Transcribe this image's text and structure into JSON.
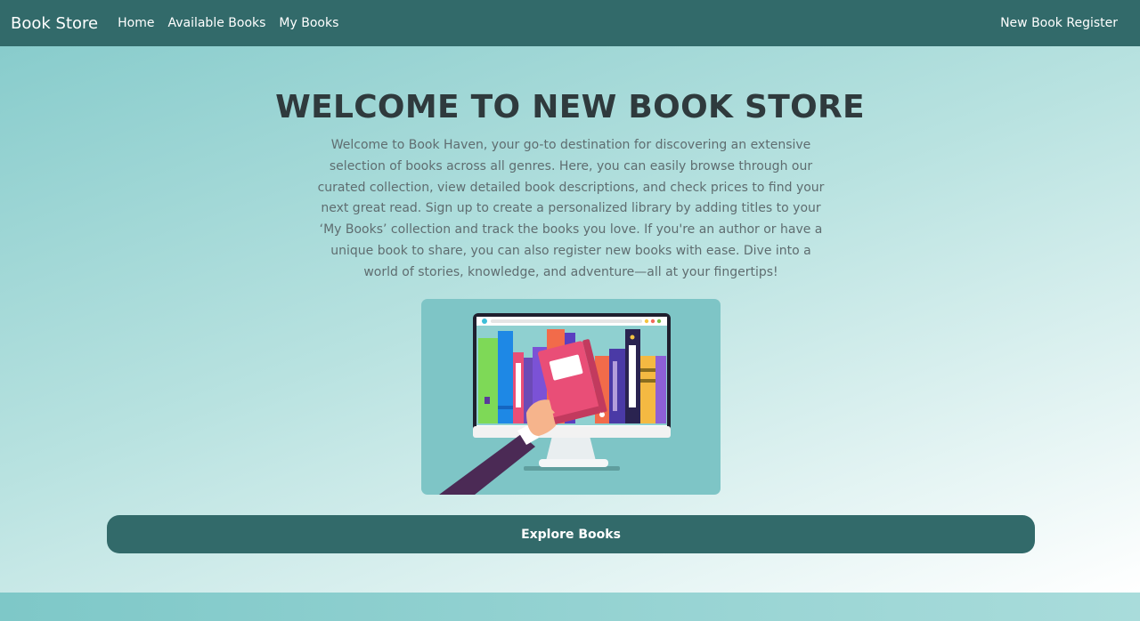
{
  "nav": {
    "brand": "Book Store",
    "links": [
      "Home",
      "Available Books",
      "My Books"
    ],
    "right_link": "New Book Register"
  },
  "hero": {
    "title": "WELCOME TO NEW BOOK STORE",
    "description": "Welcome to Book Haven, your go-to destination for discovering an extensive selection of books across all genres. Here, you can easily browse through our curated collection, view detailed book descriptions, and check prices to find your next great read. Sign up to create a personalized library by adding titles to your ‘My Books’ collection and track the books you love. If you're an author or have a unique book to share, you can also register new books with ease. Dive into a world of stories, knowledge, and adventure—all at your fingertips!",
    "button_label": "Explore Books"
  },
  "colors": {
    "navbar": "#326a6a",
    "button": "#326a6a",
    "title": "#2f3a3d",
    "text": "#5f6d70"
  },
  "icons": {
    "illustration": "hand-holding-book-monitor-illustration"
  }
}
